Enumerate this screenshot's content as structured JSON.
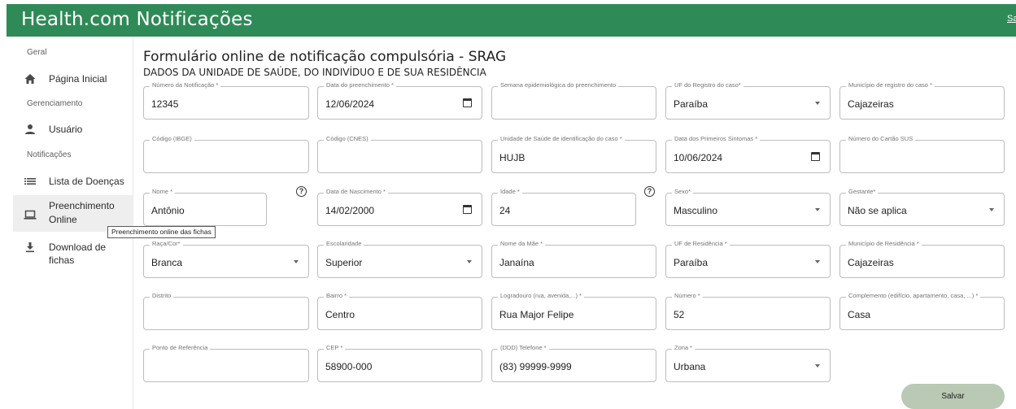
{
  "app": {
    "title": "Health.com Notificações",
    "logout_label": "Sair"
  },
  "sidebar": {
    "sections": {
      "geral": "Geral",
      "gerenciamento": "Gerenciamento",
      "notificacoes": "Notificações"
    },
    "items": {
      "home": {
        "label": "Página Inicial",
        "icon": "home-icon"
      },
      "users": {
        "label": "Usuário",
        "icon": "person-icon"
      },
      "diseases": {
        "label": "Lista de Doenças",
        "icon": "list-icon"
      },
      "online_line1": "Preenchimento",
      "online_line2": "Online",
      "download": {
        "label": "Download de fichas",
        "icon": "download-icon"
      }
    },
    "tooltip": "Preenchimento online das fichas"
  },
  "form": {
    "title": "Formulário online de notificação compulsória - SRAG",
    "subtitle": "DADOS DA UNIDADE DE SAÚDE, DO INDIVÍDUO E DE SUA RESIDÊNCIA",
    "fields": {
      "numero_notificacao": {
        "label": "Número da Notificação *",
        "value": "12345"
      },
      "data_preenchimento": {
        "label": "Data do preenchimento *",
        "value": "12/06/2024"
      },
      "semana_epidemiologica": {
        "label": "Semana epidemiológica do preenchimento",
        "value": ""
      },
      "uf_registro": {
        "label": "UF do Registro do caso*",
        "value": "Paraíba"
      },
      "municipio_registro": {
        "label": "Município de registro do caso *",
        "value": "Cajazeiras"
      },
      "codigo_ibge": {
        "label": "Código (IBGE)",
        "value": ""
      },
      "codigo_cnes": {
        "label": "Código (CNES)",
        "value": ""
      },
      "unidade_saude": {
        "label": "Unidade de Saúde de identificação do caso *",
        "value": "HUJB"
      },
      "data_sintomas": {
        "label": "Data dos Primeiros Sintomas *",
        "value": "10/06/2024"
      },
      "cartao_sus": {
        "label": "Número do Cartão SUS",
        "value": ""
      },
      "nome": {
        "label": "Nome *",
        "value": "Antônio"
      },
      "data_nascimento": {
        "label": "Data de Nascimento *",
        "value": "14/02/2000"
      },
      "idade": {
        "label": "Idade *",
        "value": "24"
      },
      "sexo": {
        "label": "Sexo*",
        "value": "Masculino"
      },
      "gestante": {
        "label": "Gestante*",
        "value": "Não se aplica"
      },
      "raca_cor": {
        "label": "Raça/Cor*",
        "value": "Branca"
      },
      "escolaridade": {
        "label": "Escolaridade",
        "value": "Superior"
      },
      "nome_mae": {
        "label": "Nome da Mãe *",
        "value": "Janaína"
      },
      "uf_residencia": {
        "label": "UF de Residência *",
        "value": "Paraíba"
      },
      "municipio_residencia": {
        "label": "Município de Residência *",
        "value": "Cajazeiras"
      },
      "distrito": {
        "label": "Distrito",
        "value": ""
      },
      "bairro": {
        "label": "Bairro *",
        "value": "Centro"
      },
      "logradouro": {
        "label": "Logradouro (rua, avenida,...) *",
        "value": "Rua Major Felipe"
      },
      "numero": {
        "label": "Número *",
        "value": "52"
      },
      "complemento": {
        "label": "Complemento (edifício, apartamento, casa, ...) *",
        "value": "Casa"
      },
      "ponto_referencia": {
        "label": "Ponto de Referência",
        "value": ""
      },
      "cep": {
        "label": "CEP *",
        "value": "58900-000"
      },
      "telefone": {
        "label": "(DDD) Telefone *",
        "value": "(83) 99999-9999"
      },
      "zona": {
        "label": "Zona *",
        "value": "Urbana"
      }
    },
    "save_label": "Salvar"
  },
  "colors": {
    "appbar": "#2e8b57",
    "save_button": "#b9c9b4"
  }
}
